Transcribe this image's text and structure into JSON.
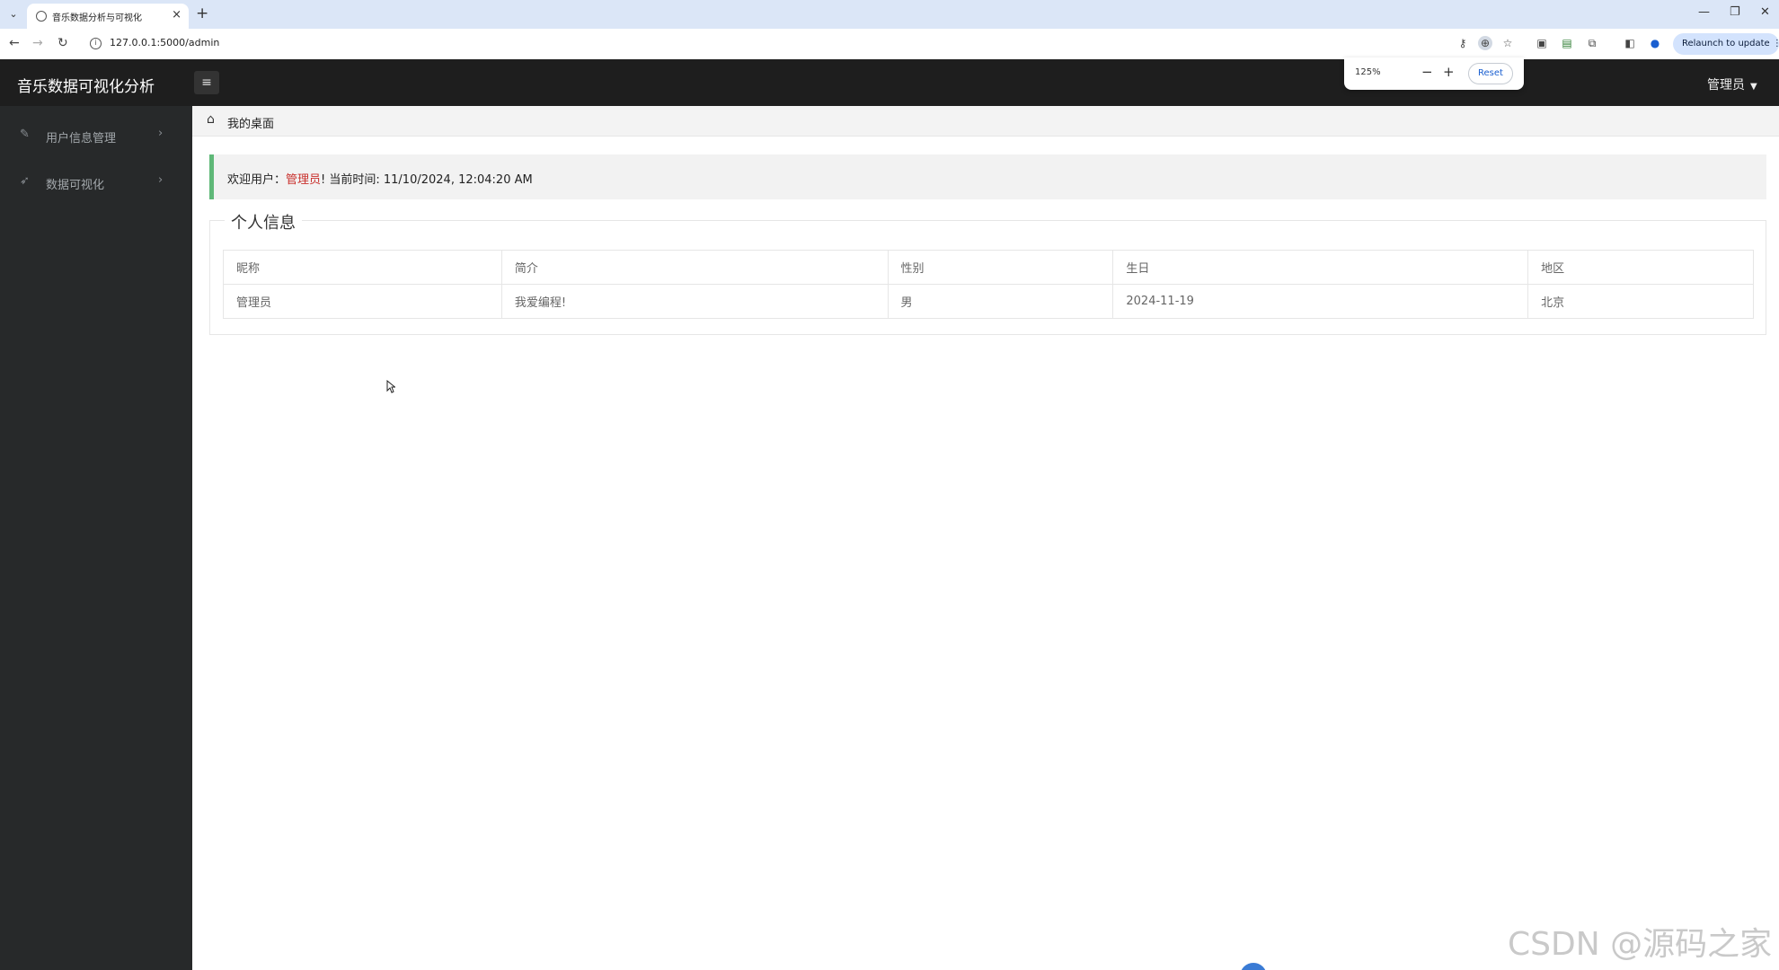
{
  "browser": {
    "tab_title": "音乐数据分析与可视化",
    "url": "127.0.0.1:5000/admin",
    "relaunch_label": "Relaunch to update",
    "zoom": {
      "percent": "125%",
      "minus": "−",
      "plus": "+",
      "reset_label": "Reset"
    }
  },
  "header": {
    "logo": "音乐数据可视化分析",
    "user_menu": "管理员"
  },
  "sidebar": {
    "items": [
      {
        "label": "用户信息管理",
        "icon": "edit-icon"
      },
      {
        "label": "数据可视化",
        "icon": "send-icon"
      }
    ]
  },
  "breadcrumb": {
    "label": "我的桌面"
  },
  "welcome": {
    "prefix": "欢迎用户：",
    "username": "管理员",
    "suffix": "! 当前时间: 11/10/2024, 12:04:20 AM"
  },
  "profile": {
    "legend": "个人信息",
    "columns": [
      "昵称",
      "简介",
      "性别",
      "生日",
      "地区"
    ],
    "row": [
      "管理员",
      "我爱编程!",
      "男",
      "2024-11-19",
      "北京"
    ]
  },
  "watermark": "CSDN @源码之家",
  "colors": {
    "accent_green": "#5fb878",
    "username_red": "#c9302c",
    "header_bg": "#1e1e1e",
    "sidebar_bg": "#27292a"
  }
}
